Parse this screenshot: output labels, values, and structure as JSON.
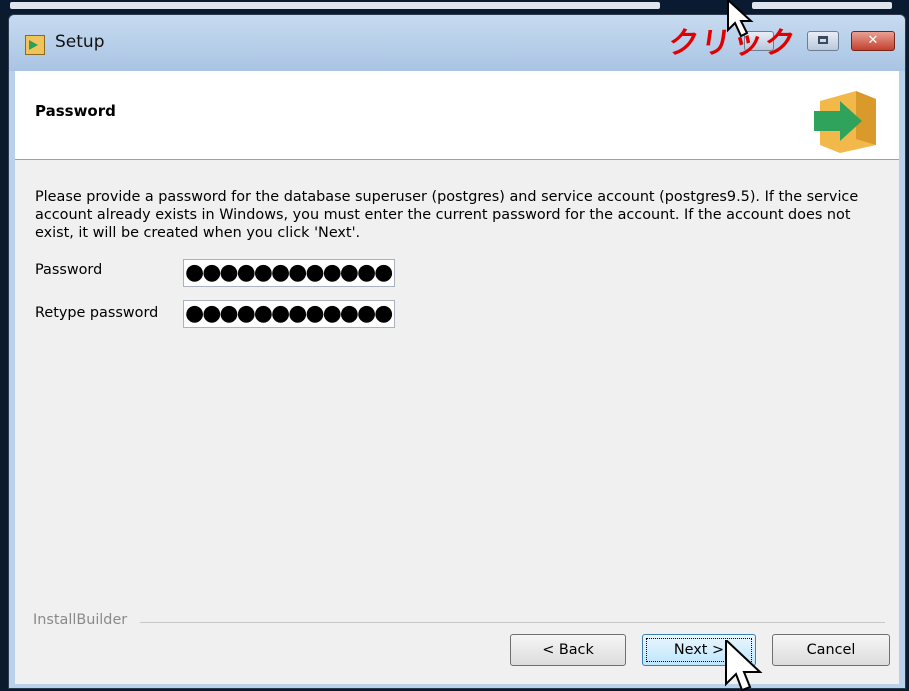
{
  "window": {
    "title": "Setup"
  },
  "annotation": {
    "text": "クリック"
  },
  "header": {
    "title": "Password"
  },
  "description": "Please provide a password for the database superuser (postgres) and service account (postgres9.5). If the service account already exists in Windows, you must enter the current password for the account. If the account does not exist, it will be created when you click 'Next'.",
  "form": {
    "password_label": "Password",
    "password_value": "●●●●●●●●●●●●",
    "retype_label": "Retype password",
    "retype_value": "●●●●●●●●●●●●"
  },
  "footer": {
    "brand": "InstallBuilder",
    "back_label": "< Back",
    "next_label": "Next >",
    "cancel_label": "Cancel"
  },
  "colors": {
    "annotation": "#e00000",
    "next_button": "#bee6fd",
    "titlebar": "#b9d1ea"
  }
}
